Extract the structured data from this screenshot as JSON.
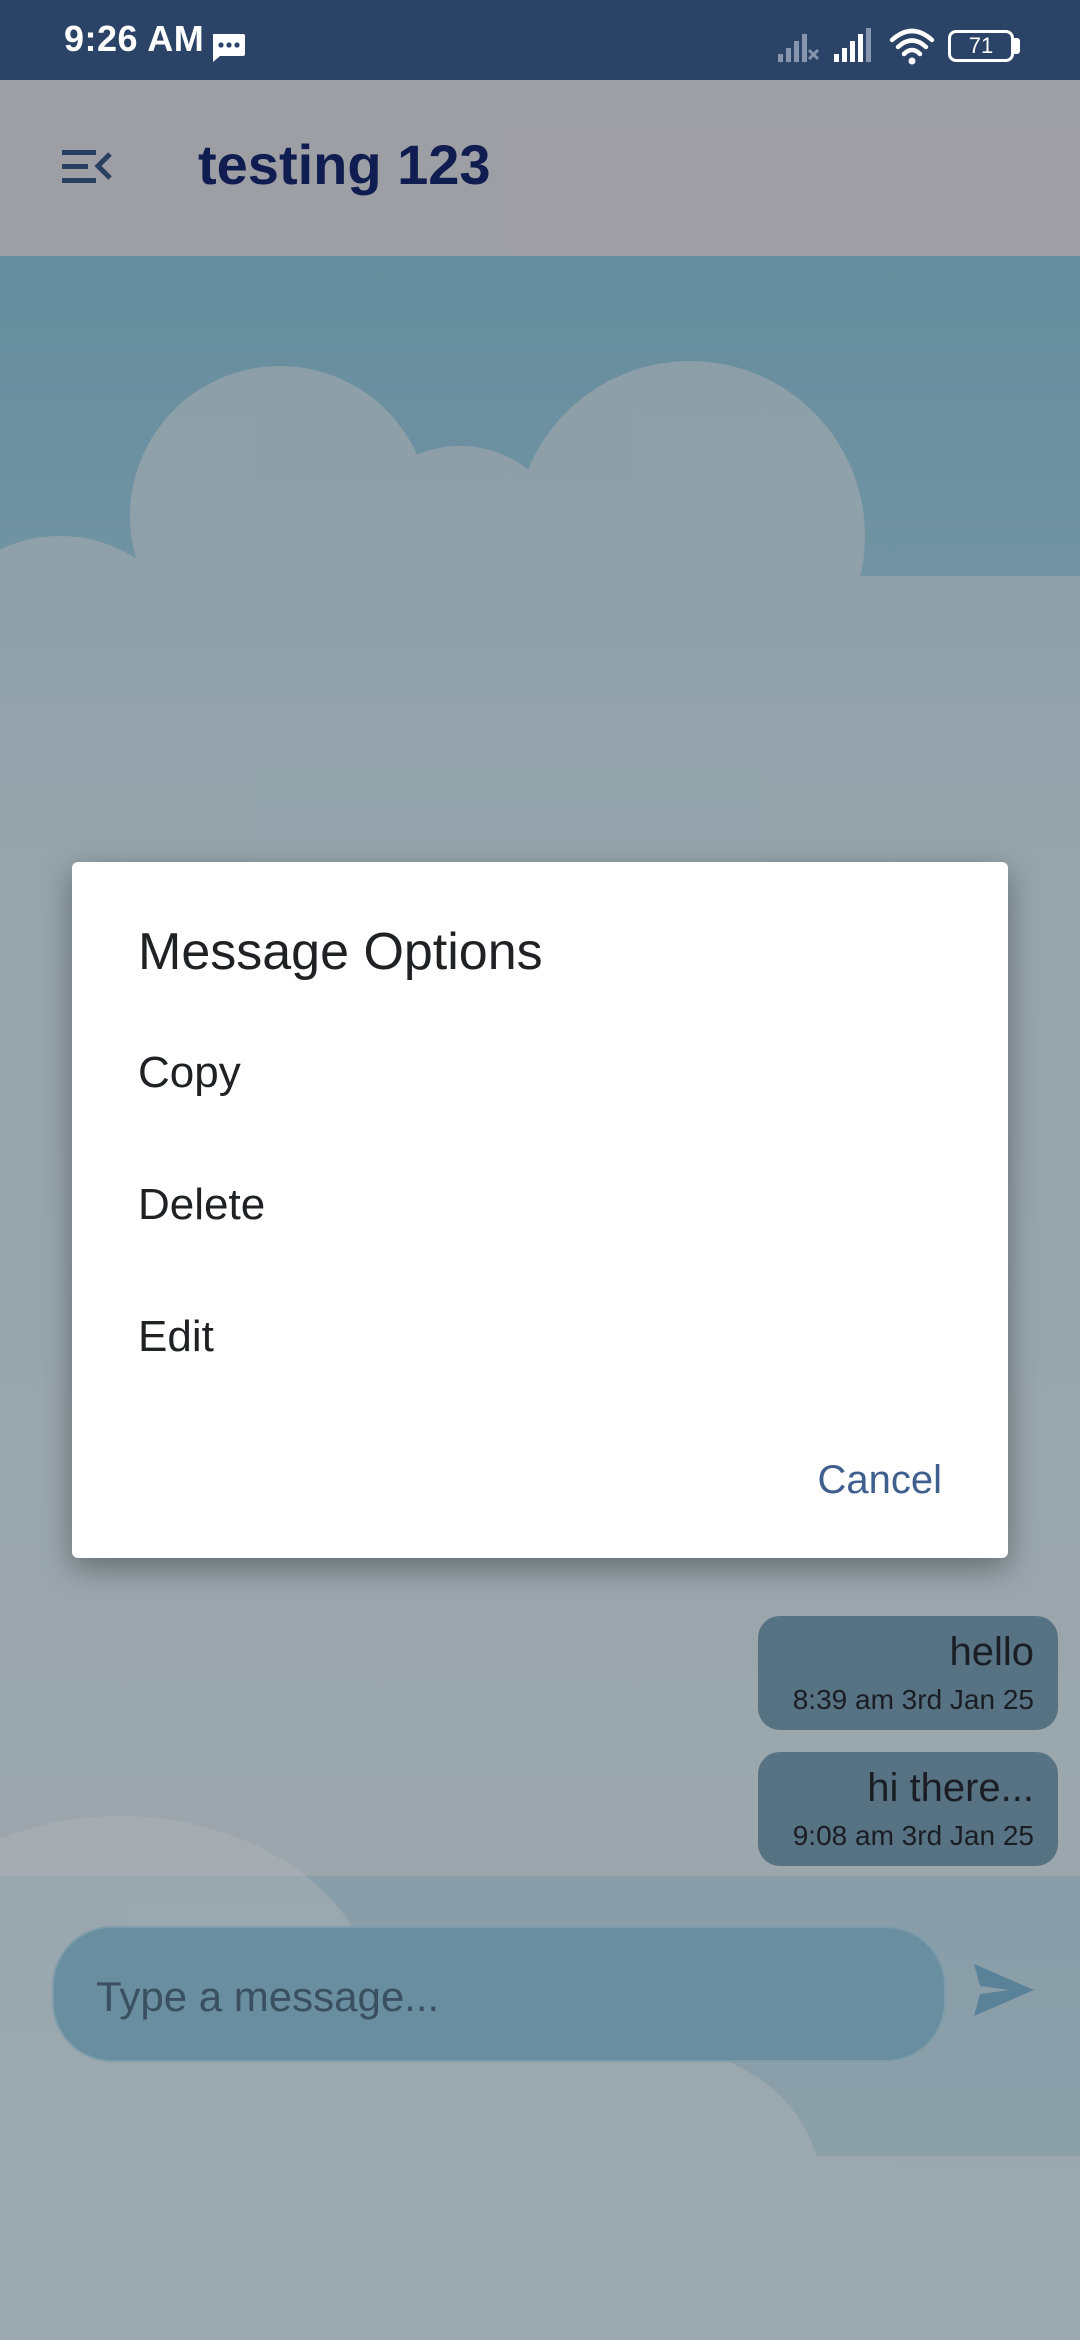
{
  "status_bar": {
    "time": "9:26 AM",
    "battery": "71",
    "icons": [
      "message-notification-icon",
      "signal-off-icon",
      "signal-icon",
      "wifi-icon",
      "battery-icon"
    ]
  },
  "app_bar": {
    "title": "testing 123",
    "menu_icon": "menu-collapse-icon"
  },
  "messages": [
    {
      "text": "hello",
      "time": "8:39 am 3rd Jan 25"
    },
    {
      "text": "hi there...",
      "time": "9:08 am 3rd Jan 25"
    }
  ],
  "composer": {
    "placeholder": "Type a message...",
    "send_icon": "send-icon"
  },
  "dialog": {
    "title": "Message Options",
    "options": [
      "Copy",
      "Delete",
      "Edit"
    ],
    "cancel": "Cancel"
  },
  "colors": {
    "status_bar": "#2b4366",
    "app_bar": "#aaaab0",
    "title": "#0f1e55",
    "bubble": "#5c7a8b",
    "accent": "#3f5f8e"
  }
}
